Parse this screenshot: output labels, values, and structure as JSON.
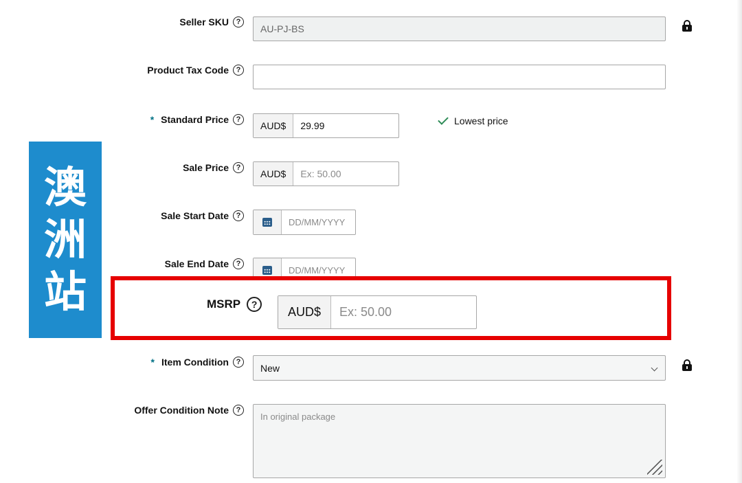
{
  "form": {
    "seller_sku": {
      "label": "Seller SKU",
      "value": "AU-PJ-BS"
    },
    "product_tax_code": {
      "label": "Product Tax Code",
      "value": ""
    },
    "standard_price": {
      "required_mark": "*",
      "label": "Standard Price",
      "currency": "AUD$",
      "value": "29.99",
      "note": "Lowest price"
    },
    "sale_price": {
      "label": "Sale Price",
      "currency": "AUD$",
      "placeholder": "Ex: 50.00"
    },
    "sale_start_date": {
      "label": "Sale Start Date",
      "placeholder": "DD/MM/YYYY"
    },
    "sale_end_date": {
      "label": "Sale End Date",
      "placeholder": "DD/MM/YYYY"
    },
    "msrp": {
      "label": "MSRP",
      "currency": "AUD$",
      "placeholder": "Ex: 50.00"
    },
    "item_condition": {
      "required_mark": "*",
      "label": "Item Condition",
      "value": "New"
    },
    "offer_condition_note": {
      "label": "Offer Condition Note",
      "placeholder": "In original package"
    }
  },
  "banner": {
    "chars": [
      "澳",
      "洲",
      "站"
    ],
    "color": "#1e8ccd"
  },
  "highlight_color": "#e60000",
  "help_icon": "?",
  "icons": {
    "help": "question-circle-icon",
    "lock": "lock-icon",
    "calendar": "calendar-icon",
    "check": "check-icon",
    "dropdown": "chevron-down-icon"
  }
}
